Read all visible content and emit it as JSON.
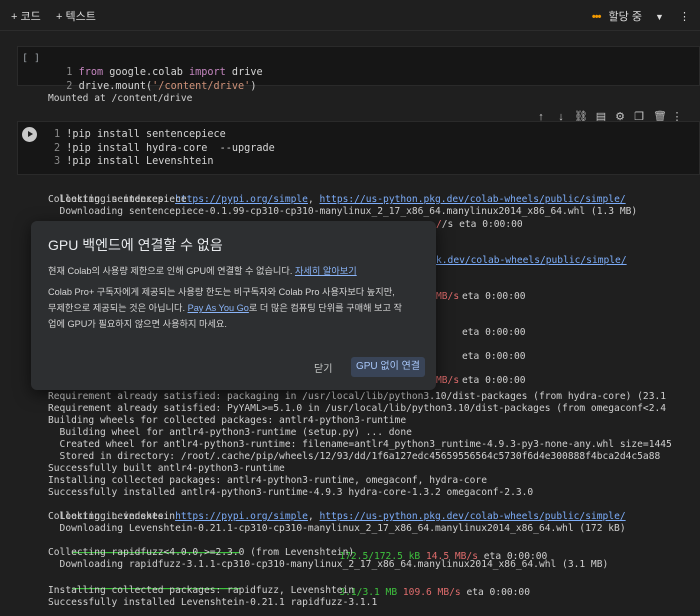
{
  "toolbar": {
    "code_label": "+ 코드",
    "text_label": "+ 텍스트",
    "status_label": "할당 중",
    "dots": "•••"
  },
  "cell1": {
    "bracket": "[ ]",
    "lines": [
      {
        "n": "1",
        "kw": "from",
        "a": " google.colab ",
        "kw2": "import",
        "b": " drive"
      },
      {
        "n": "2",
        "pre": "drive.mount(",
        "str": "'/content/drive'",
        "post": ")"
      }
    ],
    "output": "Mounted at /content/drive"
  },
  "cell2": {
    "lines": [
      {
        "n": "1",
        "text": "!pip install sentencepiece"
      },
      {
        "n": "2",
        "text": "!pip install hydra-core  --upgrade"
      },
      {
        "n": "3",
        "text": "!pip install Levenshtein"
      }
    ]
  },
  "output": {
    "indexes_prefix": "Looking in indexes: ",
    "index_url1": "https://pypi.org/simple",
    "index_sep": ", ",
    "index_url2": "https://us-python.pkg.dev/colab-wheels/public/simple/",
    "collecting_sp": "Collecting sentencepiece",
    "downloading_sp": "  Downloading sentencepiece-0.1.99-cp310-cp310-manylinux_2_17_x86_64.manylinux2014_x86_64.whl (1.3 MB)",
    "frag_eta1": "/s eta 0:00:00",
    "frag_index1": "k.dev/colab-wheels/public/simple/",
    "frag_mb1": "MB/s",
    "frag_eta2": "eta 0:00:00",
    "frag_eta3": "eta 0:00:00",
    "frag_eta4": "eta 0:00:00",
    "frag_mb2": "MB/s",
    "frag_eta5": "eta 0:00:00",
    "frag_eta6": "eta 0:00:00",
    "lines_after": [
      "Requirement already satisfied: packaging in /usr/local/lib/python3.10/dist-packages (from hydra-core) (23.1",
      "Requirement already satisfied: PyYAML>=5.1.0 in /usr/local/lib/python3.10/dist-packages (from omegaconf<2.4",
      "Building wheels for collected packages: antlr4-python3-runtime",
      "  Building wheel for antlr4-python3-runtime (setup.py) ... done",
      "  Created wheel for antlr4-python3-runtime: filename=antlr4_python3_runtime-4.9.3-py3-none-any.whl size=1445",
      "  Stored in directory: /root/.cache/pip/wheels/12/93/dd/1f6a127edc45659556564c5730f6d4e300888f4bca2d4c5a88",
      "Successfully built antlr4-python3-runtime",
      "Installing collected packages: antlr4-python3-runtime, omegaconf, hydra-core",
      "Successfully installed antlr4-python3-runtime-4.9.3 hydra-core-1.3.2 omegaconf-2.3.0"
    ],
    "indexes2_prefix": "Looking in indexes: ",
    "collecting_lev": "Collecting Levenshtein",
    "downloading_lev": "  Downloading Levenshtein-0.21.1-cp310-cp310-manylinux_2_17_x86_64.manylinux2014_x86_64.whl (172 kB)",
    "lev_bar": "━━━━━━━━━━━━━━━━━━━━━━━━━━━━━━━━━━━━━━━━",
    "lev_size": "172.5/172.5 kB",
    "lev_speed": "14.5 MB/s",
    "lev_eta": "eta 0:00:00",
    "collecting_rf": "Collecting rapidfuzz<4.0.0,>=2.3.0 (from Levenshtein)",
    "downloading_rf": "  Downloading rapidfuzz-3.1.1-cp310-cp310-manylinux_2_17_x86_64.manylinux2014_x86_64.whl (3.1 MB)",
    "rf_bar": "━━━━━━━━━━━━━━━━━━━━━━━━━━━━━━━━━━━━━━━━",
    "rf_size": "3.1/3.1 MB",
    "rf_speed": "109.6 MB/s",
    "rf_eta": "eta 0:00:00",
    "installing_final": "Installing collected packages: rapidfuzz, Levenshtein",
    "success_final": "Successfully installed Levenshtein-0.21.1 rapidfuzz-3.1.1"
  },
  "dialog": {
    "title": "GPU 백엔드에 연결할 수 없음",
    "p1_text": "현재 Colab의 사용량 제한으로 인해 GPU에 연결할 수 없습니다. ",
    "p1_link": "자세히 알아보기",
    "p2_line1": "Colab Pro+ 구독자에게 제공되는 사용량 한도는 비구독자와 Colab Pro 사용자보다 높지만,",
    "p2_line2_a": "무제한으로 제공되는 것은 아닙니다. ",
    "p2_link": "Pay As You Go",
    "p2_line2_b": "로 더 많은 컴퓨팅 단위를 구매해 보고 작",
    "p2_line3": "업에 GPU가 필요하지 않으면 사용하지 마세요.",
    "close_label": "닫기",
    "connect_label": "GPU 없이 연결"
  }
}
